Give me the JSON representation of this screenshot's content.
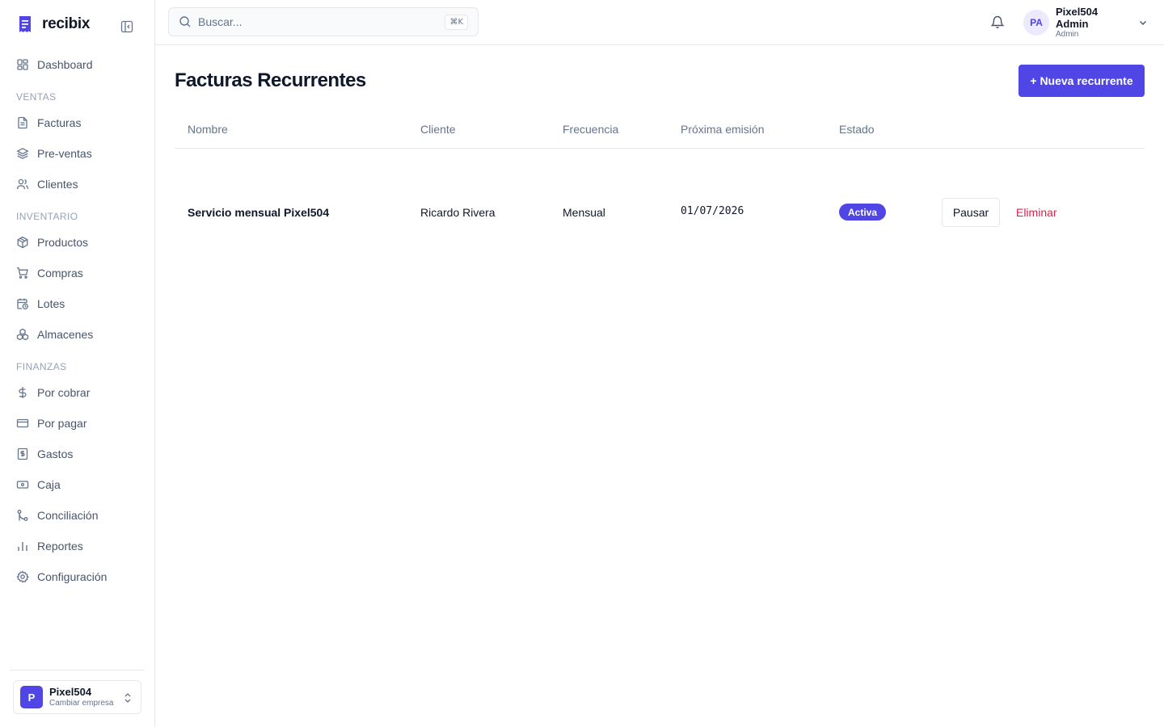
{
  "app": {
    "brand": "recibix"
  },
  "sidebar": {
    "items": [
      {
        "label": "Dashboard",
        "icon": "dashboard-icon"
      },
      {
        "section": "VENTAS"
      },
      {
        "label": "Facturas",
        "icon": "file-text-icon"
      },
      {
        "label": "Pre-ventas",
        "icon": "layers-icon"
      },
      {
        "label": "Clientes",
        "icon": "users-icon"
      },
      {
        "section": "INVENTARIO"
      },
      {
        "label": "Productos",
        "icon": "package-icon"
      },
      {
        "label": "Compras",
        "icon": "cart-icon"
      },
      {
        "label": "Lotes",
        "icon": "calendar-clock-icon"
      },
      {
        "label": "Almacenes",
        "icon": "boxes-icon"
      },
      {
        "section": "FINANZAS"
      },
      {
        "label": "Por cobrar",
        "icon": "dollar-icon"
      },
      {
        "label": "Por pagar",
        "icon": "credit-card-icon"
      },
      {
        "label": "Gastos",
        "icon": "receipt-icon"
      },
      {
        "label": "Caja",
        "icon": "banknote-icon"
      },
      {
        "label": "Conciliación",
        "icon": "git-merge-icon"
      },
      {
        "label": "Reportes",
        "icon": "bar-chart-icon"
      },
      {
        "label": "Configuración",
        "icon": "gear-icon"
      }
    ],
    "company": {
      "initial": "P",
      "name": "Pixel504",
      "action": "Cambiar empresa"
    }
  },
  "topbar": {
    "search_placeholder": "Buscar...",
    "shortcut": "⌘K",
    "user": {
      "initials": "PA",
      "name": "Pixel504 Admin",
      "role": "Admin"
    }
  },
  "main": {
    "title": "Facturas Recurrentes",
    "new_button": "+ Nueva recurrente",
    "columns": [
      "Nombre",
      "Cliente",
      "Frecuencia",
      "Próxima emisión",
      "Estado"
    ],
    "rows": [
      {
        "name": "Servicio mensual Pixel504",
        "client": "Ricardo Rivera",
        "frequency": "Mensual",
        "next_date": "01/07/2026",
        "status": "Activa",
        "pause_label": "Pausar",
        "delete_label": "Eliminar"
      }
    ]
  },
  "colors": {
    "accent": "#4f46e5",
    "danger": "#e11d48"
  }
}
